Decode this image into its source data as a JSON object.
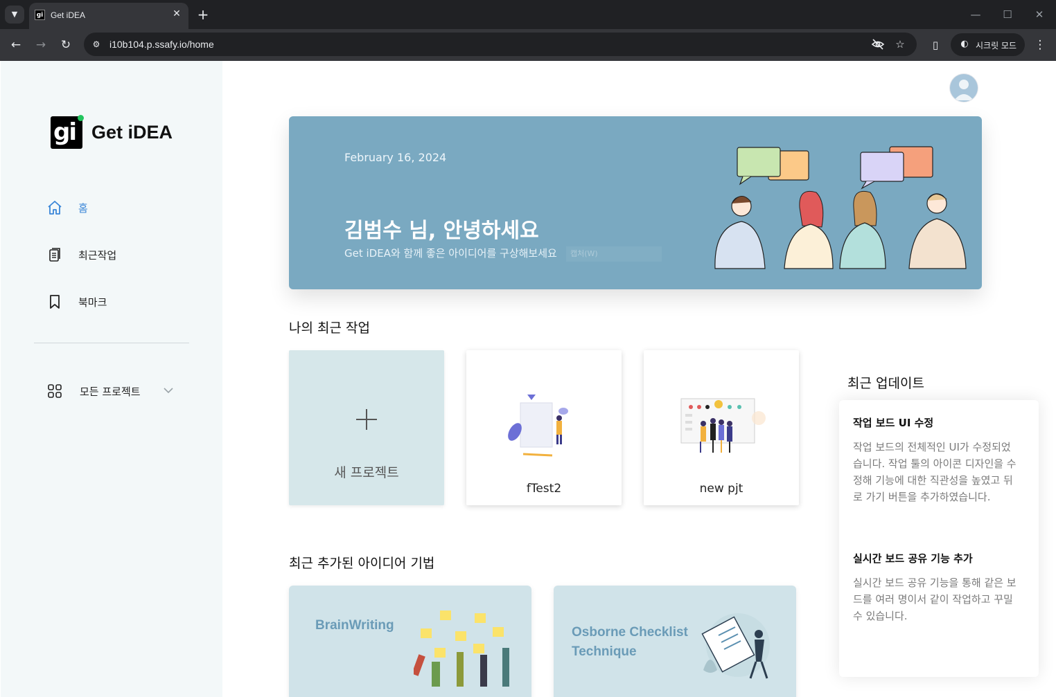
{
  "browser": {
    "tab_title": "Get iDEA",
    "favicon_text": "gi",
    "url": "i10b104.p.ssafy.io/home",
    "incognito_label": "시크릿 모드"
  },
  "sidebar": {
    "logo_mark": "gi",
    "logo_text": "Get iDEA",
    "nav": [
      {
        "label": "홈",
        "icon": "home-icon",
        "active": true
      },
      {
        "label": "최근작업",
        "icon": "clipboard-icon",
        "active": false
      },
      {
        "label": "북마크",
        "icon": "bookmark-icon",
        "active": false
      }
    ],
    "all_projects_label": "모든 프로젝트"
  },
  "banner": {
    "date": "February 16, 2024",
    "greeting": "김범수 님, 안녕하세요",
    "subtitle": "Get iDEA와 함께 좋은 아이디어를 구상해보세요",
    "ghost_text": "캡처(W)"
  },
  "recent": {
    "title": "나의 최근 작업",
    "new_project_label": "새 프로젝트",
    "projects": [
      {
        "name": "fTest2"
      },
      {
        "name": "new pjt"
      }
    ]
  },
  "updates": {
    "title": "최근 업데이트",
    "items": [
      {
        "title": "작업 보드 UI 수정",
        "body": "작업 보드의 전체적인 UI가 수정되었습니다. 작업 툴의 아이콘 디자인을 수정해 기능에 대한 직관성을 높였고 뒤로 가기 버튼을 추가하였습니다."
      },
      {
        "title": "실시간 보드 공유 기능 추가",
        "body": "실시간 보드 공유 기능을 통해 같은 보드를 여러 명이서 같이 작업하고 꾸밀 수 있습니다."
      }
    ]
  },
  "techniques": {
    "title": "최근 추가된 아이디어 기법",
    "items": [
      {
        "name": "BrainWriting"
      },
      {
        "name": "Osborne Checklist Technique"
      }
    ]
  },
  "colors": {
    "accent": "#3a86d8",
    "banner": "#7aa9c1",
    "technique_label": "#6a9bb7",
    "new_card": "#d6e7ea",
    "sidebar_bg": "#f3f8f9"
  }
}
